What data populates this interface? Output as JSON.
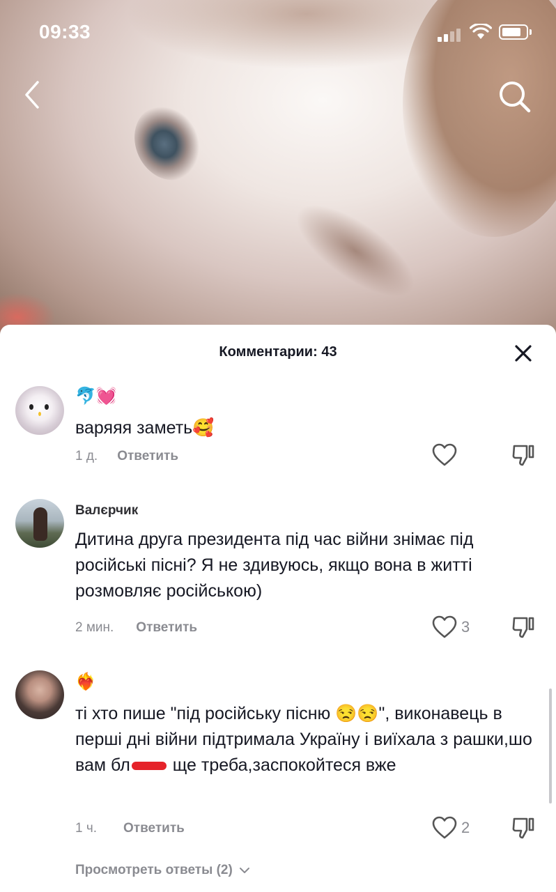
{
  "status_bar": {
    "time": "09:33"
  },
  "sheet": {
    "title": "Комментарии: 43"
  },
  "comments": [
    {
      "username": "🐬💓",
      "text": "варяяя заметь🥰",
      "time": "1 д.",
      "reply_label": "Ответить",
      "likes": ""
    },
    {
      "username": "Валєрчик",
      "text": "Дитина друга президента під час війни знімає під російські пісні? Я не здивуюсь, якщо вона в житті розмовляє російською)",
      "time": "2 мин.",
      "reply_label": "Ответить",
      "likes": "3"
    },
    {
      "username": "❤️‍🔥",
      "text_part1": "ті хто пише \"під російську пісню 😒😒\", виконавець в перші дні війни підтримала Україну і виїхала з рашки,шо вам бл",
      "text_part2": " ще треба,заспокойтеся вже",
      "time": "1 ч.",
      "reply_label": "Ответить",
      "likes": "2",
      "view_replies": "Просмотреть ответы (2)"
    }
  ],
  "colors": {
    "text": "#161823",
    "muted": "#8a8b91",
    "redaction": "#e5232a"
  },
  "icons": [
    "back-chevron-icon",
    "search-icon",
    "close-icon",
    "heart-icon",
    "dislike-icon",
    "chevron-down-icon"
  ]
}
